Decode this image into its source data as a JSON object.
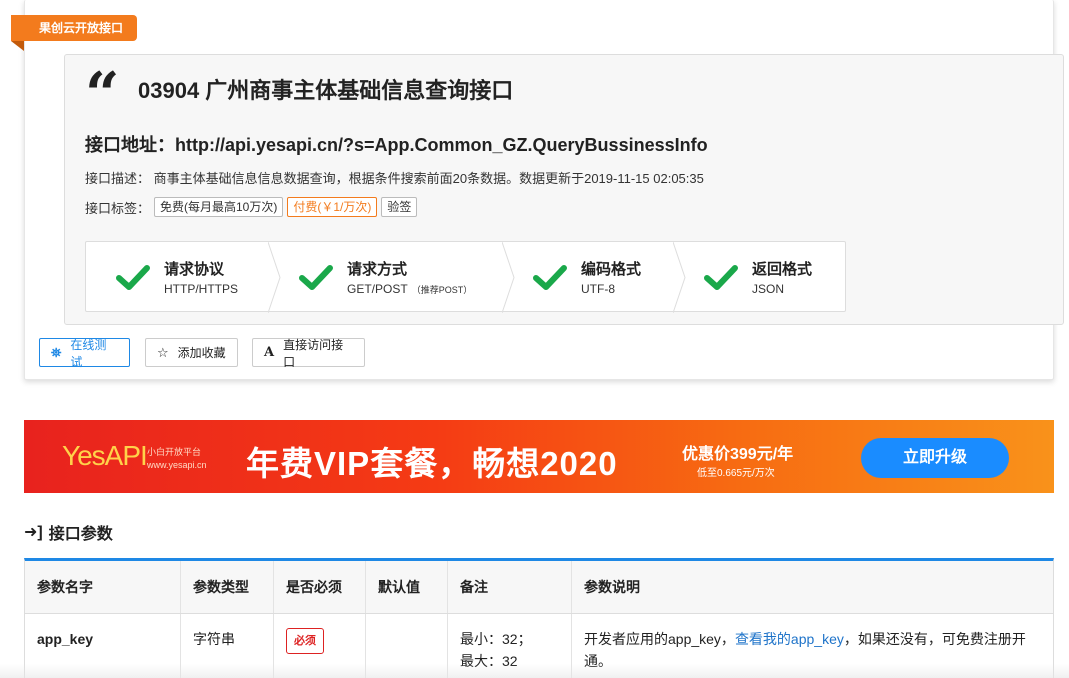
{
  "ribbon": "果创云开放接口",
  "api": {
    "title": "03904 广州商事主体基础信息查询接口",
    "address_label": "接口地址：",
    "address": "http://api.yesapi.cn/?s=App.Common_GZ.QueryBussinessInfo",
    "desc_label": "接口描述：",
    "desc": "商事主体基础信息信息数据查询，根据条件搜索前面20条数据。数据更新于2019-11-15 02:05:35",
    "tags_label": "接口标签：",
    "tags": [
      "免费(每月最高10万次)",
      "付费(￥1/万次)",
      "验签"
    ]
  },
  "steps": [
    {
      "title": "请求协议",
      "sub": "HTTP/HTTPS",
      "note": ""
    },
    {
      "title": "请求方式",
      "sub": "GET/POST",
      "note": "（推荐POST）"
    },
    {
      "title": "编码格式",
      "sub": "UTF-8",
      "note": ""
    },
    {
      "title": "返回格式",
      "sub": "JSON",
      "note": ""
    }
  ],
  "buttons": {
    "test": "在线测试",
    "favorite": "添加收藏",
    "visit": "直接访问接口"
  },
  "banner": {
    "logo": "YesAPI",
    "logo_sub1": "小白开放平台",
    "logo_sub2": "www.yesapi.cn",
    "slogan": "年费VIP套餐，畅想2020",
    "price": "优惠价399元/年",
    "price_sub": "低至0.665元/万次",
    "button": "立即升级"
  },
  "params": {
    "section_title": "接口参数",
    "headers": [
      "参数名字",
      "参数类型",
      "是否必须",
      "默认值",
      "备注",
      "参数说明"
    ],
    "rows": [
      {
        "name": "app_key",
        "type": "字符串",
        "required": "必须",
        "default": "",
        "note_min": "最小：32；",
        "note_max": "最大：32",
        "desc_before": "开发者应用的app_key，",
        "desc_link": "查看我的app_key",
        "desc_after": "，如果还没有，可免费注册开通。"
      }
    ]
  },
  "colors": {
    "accent": "#1e88e5",
    "ribbon": "#f37b1d",
    "check": "#1aa84a",
    "required": "#dd2222"
  }
}
